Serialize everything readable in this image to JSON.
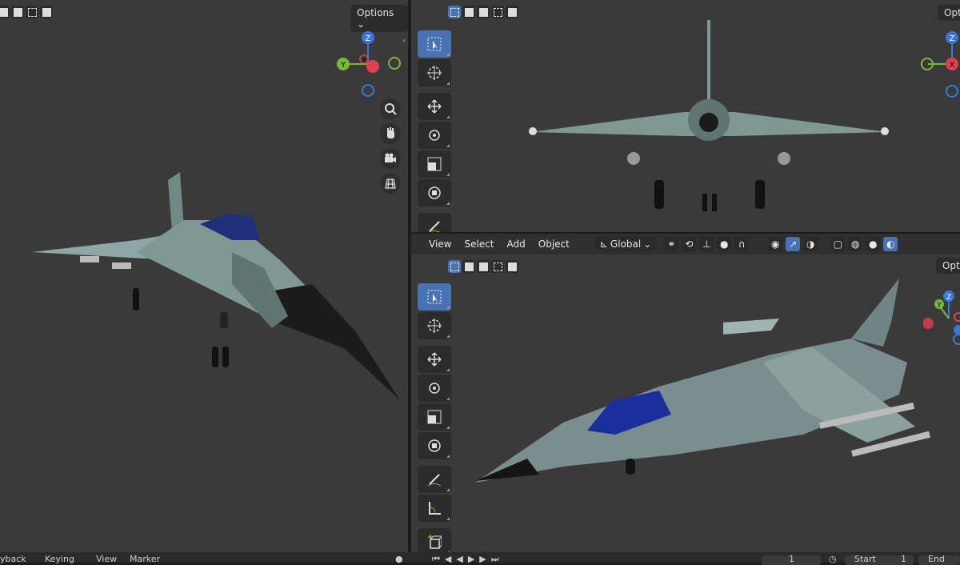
{
  "viewports": {
    "left": {
      "options_label": "Options"
    },
    "top_right": {
      "options_label": "Opti"
    },
    "bottom_right": {
      "options_label": "Optio"
    }
  },
  "gizmo": {
    "z": "Z",
    "y": "Y",
    "x": "X"
  },
  "header": {
    "menus": [
      "View",
      "Select",
      "Add",
      "Object"
    ],
    "transform_orientation": "Global"
  },
  "timeline": {
    "items": [
      "yback",
      "Keying",
      "View",
      "Marker"
    ],
    "frame_current": "1",
    "start_label": "Start",
    "start_value": "1",
    "end_label": "End"
  },
  "colors": {
    "x_axis": "#e0404f",
    "y_axis": "#7ab83a",
    "z_axis": "#3b76d1",
    "accent": "#4772b3"
  }
}
